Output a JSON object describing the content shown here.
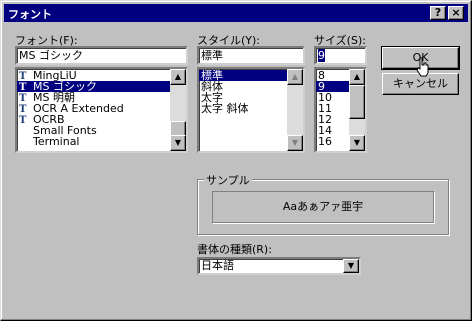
{
  "window": {
    "title": "フォント",
    "help_button": "?",
    "close_button": "×"
  },
  "font": {
    "label": "フォント(F):",
    "value": "MS ゴシック",
    "items": [
      {
        "name": "MingLiU",
        "icon": "truetype-icon",
        "selected": false
      },
      {
        "name": "MS ゴシック",
        "icon": "truetype-icon",
        "selected": true
      },
      {
        "name": "MS 明朝",
        "icon": "truetype-icon",
        "selected": false
      },
      {
        "name": "OCR A Extended",
        "icon": "truetype-icon",
        "selected": false
      },
      {
        "name": "OCRB",
        "icon": "truetype-icon",
        "selected": false
      },
      {
        "name": "Small Fonts",
        "icon": "",
        "selected": false
      },
      {
        "name": "Terminal",
        "icon": "",
        "selected": false
      }
    ]
  },
  "style": {
    "label": "スタイル(Y):",
    "value": "標準",
    "items": [
      {
        "name": "標準",
        "selected": true
      },
      {
        "name": "斜体",
        "selected": false
      },
      {
        "name": "太字",
        "selected": false
      },
      {
        "name": "太字 斜体",
        "selected": false
      }
    ]
  },
  "size": {
    "label": "サイズ(S):",
    "value": "9",
    "items": [
      {
        "name": "8",
        "selected": false
      },
      {
        "name": "9",
        "selected": true
      },
      {
        "name": "10",
        "selected": false
      },
      {
        "name": "11",
        "selected": false
      },
      {
        "name": "12",
        "selected": false
      },
      {
        "name": "14",
        "selected": false
      },
      {
        "name": "16",
        "selected": false
      }
    ]
  },
  "buttons": {
    "ok": "OK",
    "cancel": "キャンセル"
  },
  "sample": {
    "label": "サンプル",
    "text": "Aaあぁアァ亜宇"
  },
  "script": {
    "label": "書体の種類(R):",
    "value": "日本語"
  },
  "colors": {
    "titlebar": "#000080",
    "selection": "#000080",
    "face": "#c0c0c0"
  }
}
